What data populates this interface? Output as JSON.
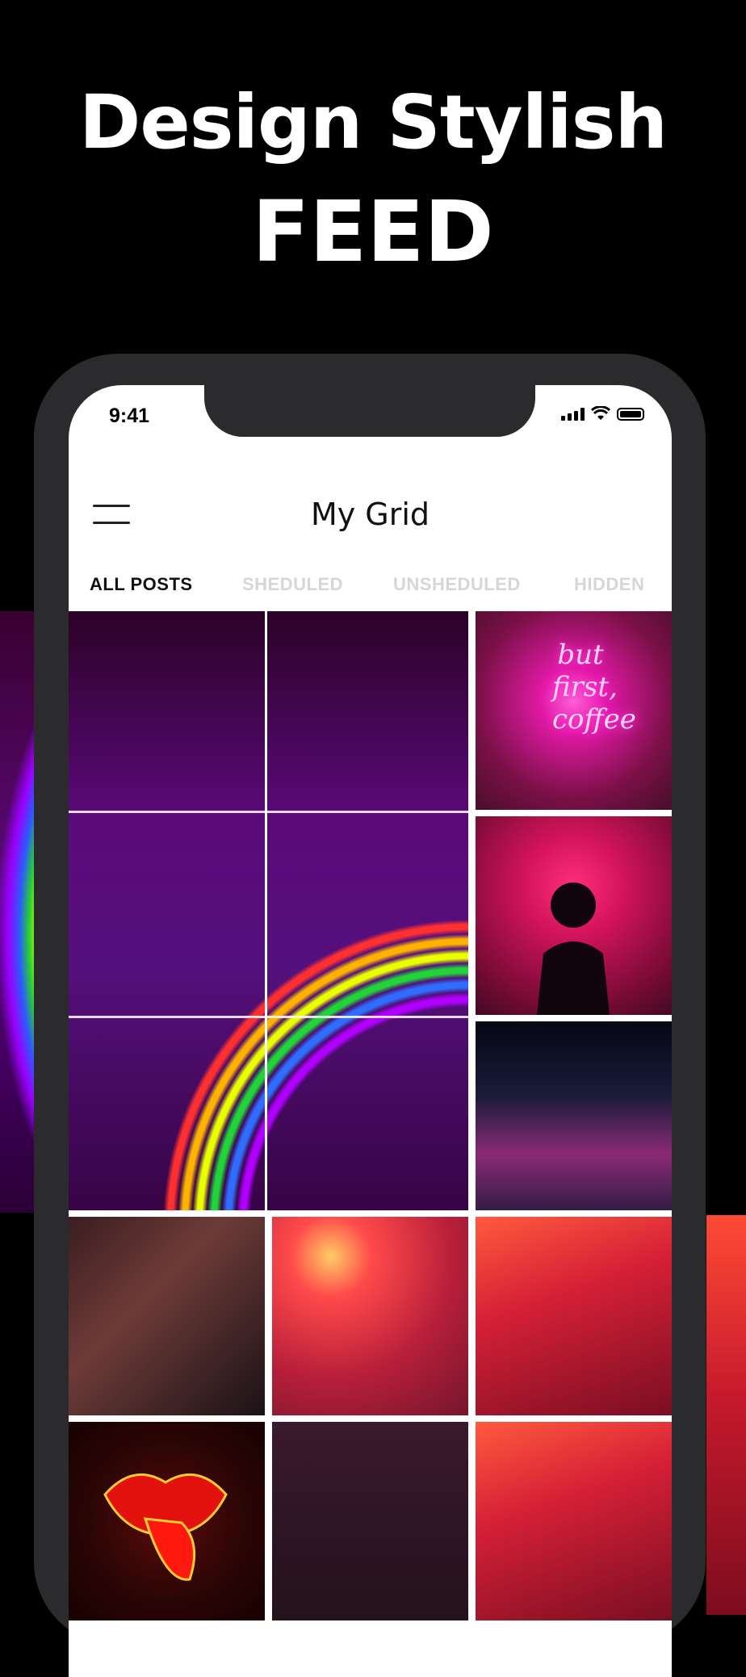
{
  "headline": {
    "line1": "Design Stylish",
    "line2": "FEED"
  },
  "status_bar": {
    "time": "9:41"
  },
  "app": {
    "title": "My Grid"
  },
  "tabs": [
    {
      "label": "ALL POSTS",
      "active": true
    },
    {
      "label": "SHEDULED",
      "active": false
    },
    {
      "label": "UNSHEDULED",
      "active": false
    },
    {
      "label": "HIDDEN",
      "active": false
    }
  ],
  "grid": {
    "coffee_sign": "but first, coffee"
  },
  "icons": [
    "menu-icon",
    "signal-icon",
    "wifi-icon",
    "battery-icon"
  ],
  "colors": {
    "background": "#000000",
    "phone_frame": "#2b2b2d",
    "active_tab": "#111111",
    "inactive_tab": "#d6d6d6"
  }
}
